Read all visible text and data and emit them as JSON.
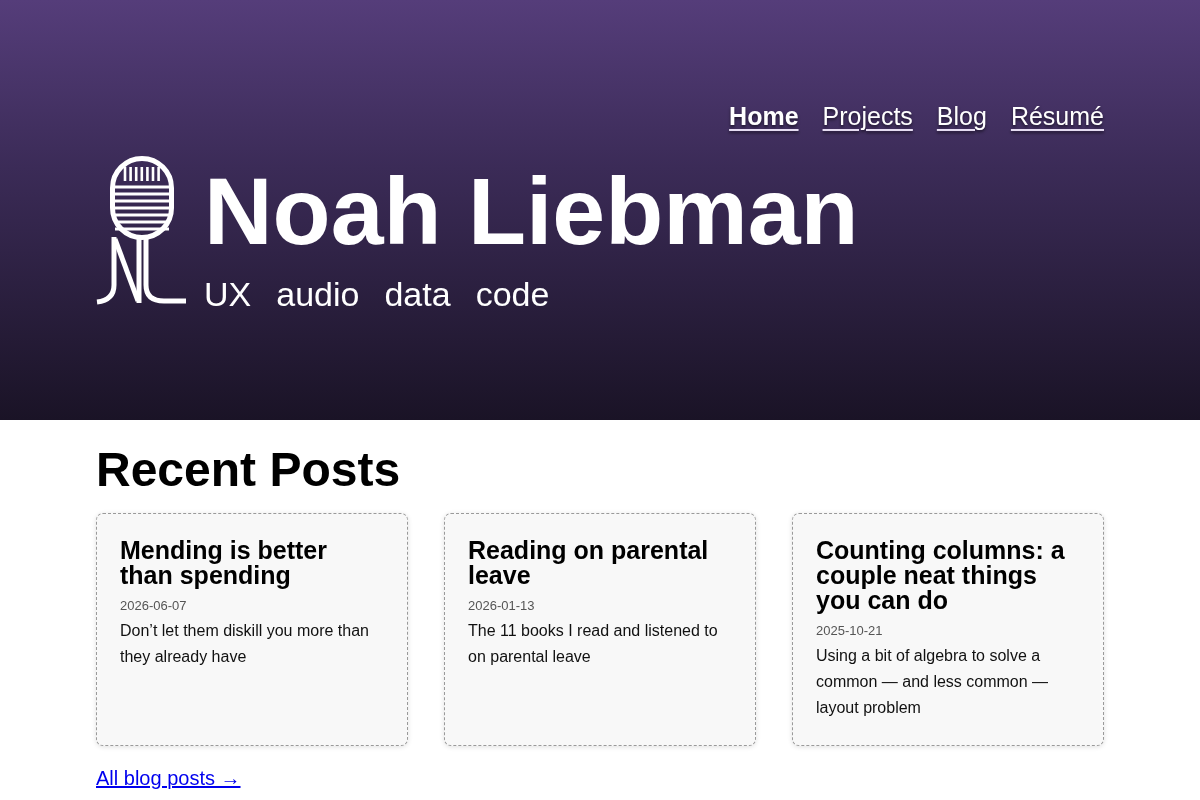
{
  "nav": [
    {
      "label": "Home",
      "selected": true
    },
    {
      "label": "Projects",
      "selected": false
    },
    {
      "label": "Blog",
      "selected": false
    },
    {
      "label": "Résumé",
      "selected": false
    }
  ],
  "hero": {
    "name": "Noah Liebman",
    "tagline": [
      "UX",
      "audio",
      "data",
      "code"
    ]
  },
  "recent_posts": {
    "heading": "Recent Posts",
    "posts": [
      {
        "title": "Mending is better than spending",
        "date": "2026-06-07",
        "summary": "Don’t let them diskill you more than they already have"
      },
      {
        "title": "Reading on parental leave",
        "date": "2026-01-13",
        "summary": "The 11 books I read and listened to on parental leave"
      },
      {
        "title": "Counting columns: a couple neat things you can do",
        "date": "2025-10-21",
        "summary": "Using a bit of algebra to solve a common — and less common — layout problem"
      }
    ],
    "all_posts_link": "All blog posts →"
  }
}
